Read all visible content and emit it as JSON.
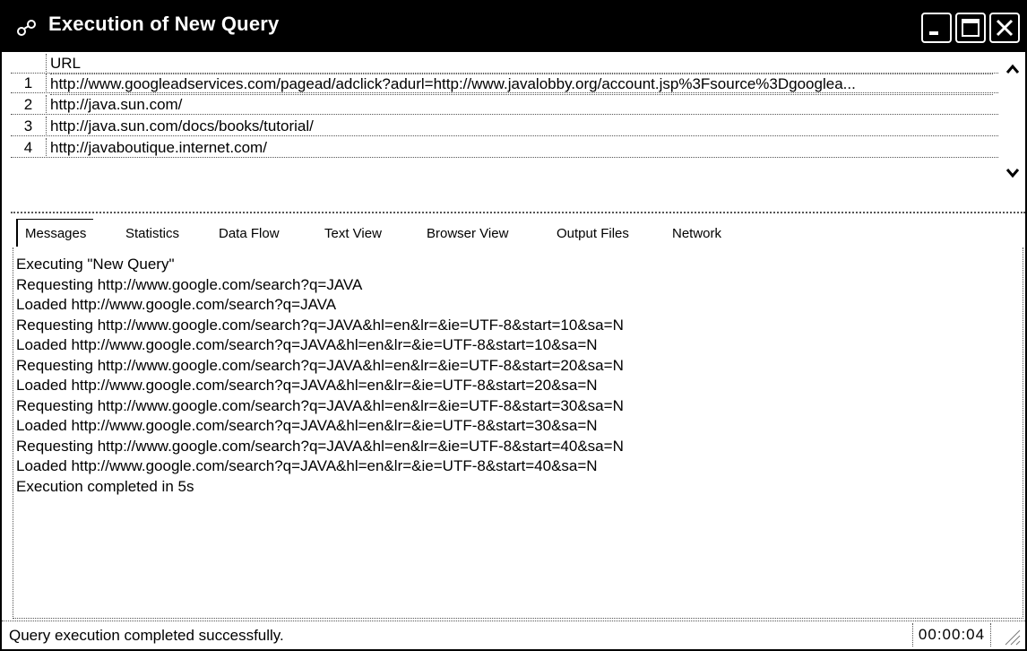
{
  "window": {
    "title": "Execution of New Query",
    "icon": "query-icon"
  },
  "grid": {
    "column_header": "URL",
    "rows": [
      {
        "num": "1",
        "url": "http://www.googleadservices.com/pagead/adclick?adurl=http://www.javalobby.org/account.jsp%3Fsource%3Dgooglea..."
      },
      {
        "num": "2",
        "url": "http://java.sun.com/"
      },
      {
        "num": "3",
        "url": "http://java.sun.com/docs/books/tutorial/"
      },
      {
        "num": "4",
        "url": "http://javaboutique.internet.com/"
      }
    ]
  },
  "tabs": [
    {
      "label": "Messages",
      "active": true
    },
    {
      "label": "Statistics"
    },
    {
      "label": "Data Flow"
    },
    {
      "label": "Text View"
    },
    {
      "label": "Browser View"
    },
    {
      "label": "Output Files"
    },
    {
      "label": "Network"
    }
  ],
  "messages": [
    "Executing \"New Query\"",
    "Requesting http://www.google.com/search?q=JAVA",
    "Loaded http://www.google.com/search?q=JAVA",
    "Requesting http://www.google.com/search?q=JAVA&hl=en&lr=&ie=UTF-8&start=10&sa=N",
    "Loaded http://www.google.com/search?q=JAVA&hl=en&lr=&ie=UTF-8&start=10&sa=N",
    "Requesting http://www.google.com/search?q=JAVA&hl=en&lr=&ie=UTF-8&start=20&sa=N",
    "Loaded http://www.google.com/search?q=JAVA&hl=en&lr=&ie=UTF-8&start=20&sa=N",
    "Requesting http://www.google.com/search?q=JAVA&hl=en&lr=&ie=UTF-8&start=30&sa=N",
    "Loaded http://www.google.com/search?q=JAVA&hl=en&lr=&ie=UTF-8&start=30&sa=N",
    "Requesting http://www.google.com/search?q=JAVA&hl=en&lr=&ie=UTF-8&start=40&sa=N",
    "Loaded http://www.google.com/search?q=JAVA&hl=en&lr=&ie=UTF-8&start=40&sa=N",
    "Execution completed in 5s"
  ],
  "status": {
    "text": "Query execution completed successfully.",
    "elapsed": "00:00:04"
  }
}
